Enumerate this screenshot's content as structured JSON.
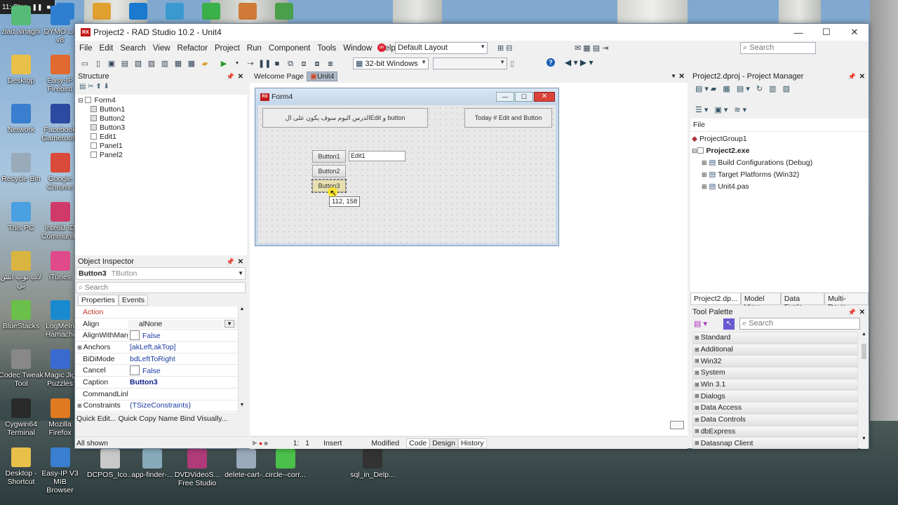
{
  "desktop": {
    "recorder_label": "11: Stop",
    "icons_left": [
      {
        "label": "ziad alnaghi",
        "color": "#5b7"
      },
      {
        "label": "Desktop",
        "color": "#e8c04a"
      },
      {
        "label": "Network",
        "color": "#3a7ed0"
      },
      {
        "label": "Recycle Bin",
        "color": "#9ab"
      },
      {
        "label": "This PC",
        "color": "#4aa0e0"
      },
      {
        "label": "لاب توب اتش بي",
        "color": "#d9b440"
      },
      {
        "label": "BlueStacks",
        "color": "#6ac04a"
      },
      {
        "label": "Codec Tweak Tool",
        "color": "#888"
      },
      {
        "label": "Cygwin64 Terminal",
        "color": "#2a2a2a"
      },
      {
        "label": "Desktop - Shortcut",
        "color": "#e8c04a"
      }
    ],
    "icons_col2": [
      {
        "label": "DYMO La v8",
        "color": "#2f7fd0"
      },
      {
        "label": "Easy-IP Firebird",
        "color": "#e06a30"
      },
      {
        "label": "Facebook Gameroom",
        "color": "#2b4aa0"
      },
      {
        "label": "Google Chrome",
        "color": "#d94a3a"
      },
      {
        "label": "IntelliJ ID Community",
        "color": "#d03a6a"
      },
      {
        "label": "iTunes",
        "color": "#e04a8a"
      },
      {
        "label": "LogMeIn Hamachi",
        "color": "#1a8ad0"
      },
      {
        "label": "Magic Jig Puzzles",
        "color": "#3a6ad0"
      },
      {
        "label": "Mozilla Firefox",
        "color": "#e07a20"
      },
      {
        "label": "Easy-IP V3 MIB Browser",
        "color": "#3a7ed0"
      }
    ],
    "bottom_icons": [
      {
        "label": "DCPOS_Ico...",
        "color": "#c9c9c9"
      },
      {
        "label": "app-finder-...",
        "color": "#8ab"
      },
      {
        "label": "DVDVideoS... Free Studio",
        "color": "#b03a7a"
      },
      {
        "label": "delete-cart-...",
        "color": "#9ab"
      },
      {
        "label": "circle--corr...",
        "color": "#4ac04a"
      },
      {
        "label": "sql_in_Delp...",
        "color": "#333"
      }
    ]
  },
  "window": {
    "title": "Project2 - RAD Studio 10.2 - Unit4",
    "logo": "RX",
    "menu": [
      "File",
      "Edit",
      "Search",
      "View",
      "Refactor",
      "Project",
      "Run",
      "Component",
      "Tools",
      "Window",
      "Help"
    ],
    "layout_combo": "Default Layout",
    "platform_combo": "32-bit Windows",
    "search_placeholder": "Search"
  },
  "structure": {
    "title": "Structure",
    "root": "Form4",
    "items": [
      "Button1",
      "Button2",
      "Button3",
      "Edit1",
      "Panel1",
      "Panel2"
    ]
  },
  "editor": {
    "tabs": [
      "Welcome Page",
      "Unit4"
    ],
    "form": {
      "title": "Form4",
      "logo": "RX",
      "panel1_caption": "الدرس اليوم سوف يكون على الEdit و button",
      "panel2_caption": "Today # Edit and Button",
      "buttons": [
        "Button1",
        "Button2",
        "Button3"
      ],
      "edit_text": "Edit1",
      "tooltip": "112, 158"
    },
    "status": {
      "position": "1:   1",
      "mode": "Insert",
      "state": "Modified",
      "tabs": [
        "Code",
        "Design",
        "History"
      ]
    }
  },
  "object_inspector": {
    "title": "Object Inspector",
    "selected_name": "Button3",
    "selected_type": "TButton",
    "search_placeholder": "Search",
    "tabs": [
      "Properties",
      "Events"
    ],
    "rows": [
      {
        "key": "Action",
        "value": "",
        "highlight": true
      },
      {
        "key": "Align",
        "value": "alNone",
        "dropdown": true
      },
      {
        "key": "AlignWithMargins",
        "value": "False",
        "checkbox": true
      },
      {
        "key": "Anchors",
        "value": "[akLeft,akTop]",
        "expand": true
      },
      {
        "key": "BiDiMode",
        "value": "bdLeftToRight"
      },
      {
        "key": "Cancel",
        "value": "False",
        "checkbox": true
      },
      {
        "key": "Caption",
        "value": "Button3",
        "bold": true
      },
      {
        "key": "CommandLinkHint",
        "value": ""
      },
      {
        "key": "Constraints",
        "value": "(TSizeConstraints)",
        "expand": true
      }
    ],
    "quick_actions": "Quick Edit...  Quick Copy Name  Bind Visually...",
    "footer": "All shown"
  },
  "project_manager": {
    "title": "Project2.dproj - Project Manager",
    "file_label": "File",
    "group": "ProjectGroup1",
    "project": "Project2.exe",
    "children": [
      "Build Configurations (Debug)",
      "Target Platforms (Win32)",
      "Unit4.pas"
    ],
    "bottom_tabs": [
      "Project2.dp...",
      "Model View",
      "Data Explo...",
      "Multi-Devic..."
    ]
  },
  "tool_palette": {
    "title": "Tool Palette",
    "search_placeholder": "Search",
    "categories": [
      "Standard",
      "Additional",
      "Win32",
      "System",
      "Win 3.1",
      "Dialogs",
      "Data Access",
      "Data Controls",
      "dbExpress",
      "Datasnap Client"
    ]
  }
}
